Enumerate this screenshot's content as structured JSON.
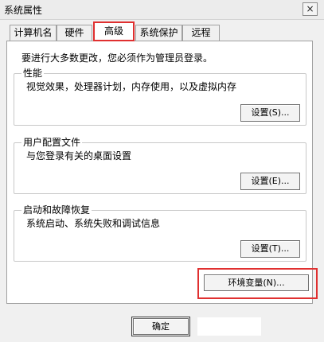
{
  "window": {
    "title": "系统属性",
    "close_glyph": "×"
  },
  "tabs": [
    {
      "label": "计算机名",
      "active": false
    },
    {
      "label": "硬件",
      "active": false
    },
    {
      "label": "高级",
      "active": true
    },
    {
      "label": "系统保护",
      "active": false
    },
    {
      "label": "远程",
      "active": false
    }
  ],
  "advanced": {
    "admin_note": "要进行大多数更改，您必须作为管理员登录。",
    "performance": {
      "title": "性能",
      "description": "视觉效果，处理器计划，内存使用，以及虚拟内存",
      "button": "设置(S)..."
    },
    "user_profiles": {
      "title": "用户配置文件",
      "description": "与您登录有关的桌面设置",
      "button": "设置(E)..."
    },
    "startup_recovery": {
      "title": "启动和故障恢复",
      "description": "系统启动、系统失败和调试信息",
      "button": "设置(T)..."
    },
    "env_button": "环境变量(N)..."
  },
  "footer": {
    "ok": "确定"
  },
  "colors": {
    "highlight": "#e03030",
    "panel": "#ffffff",
    "dialog": "#f0f0f0"
  }
}
